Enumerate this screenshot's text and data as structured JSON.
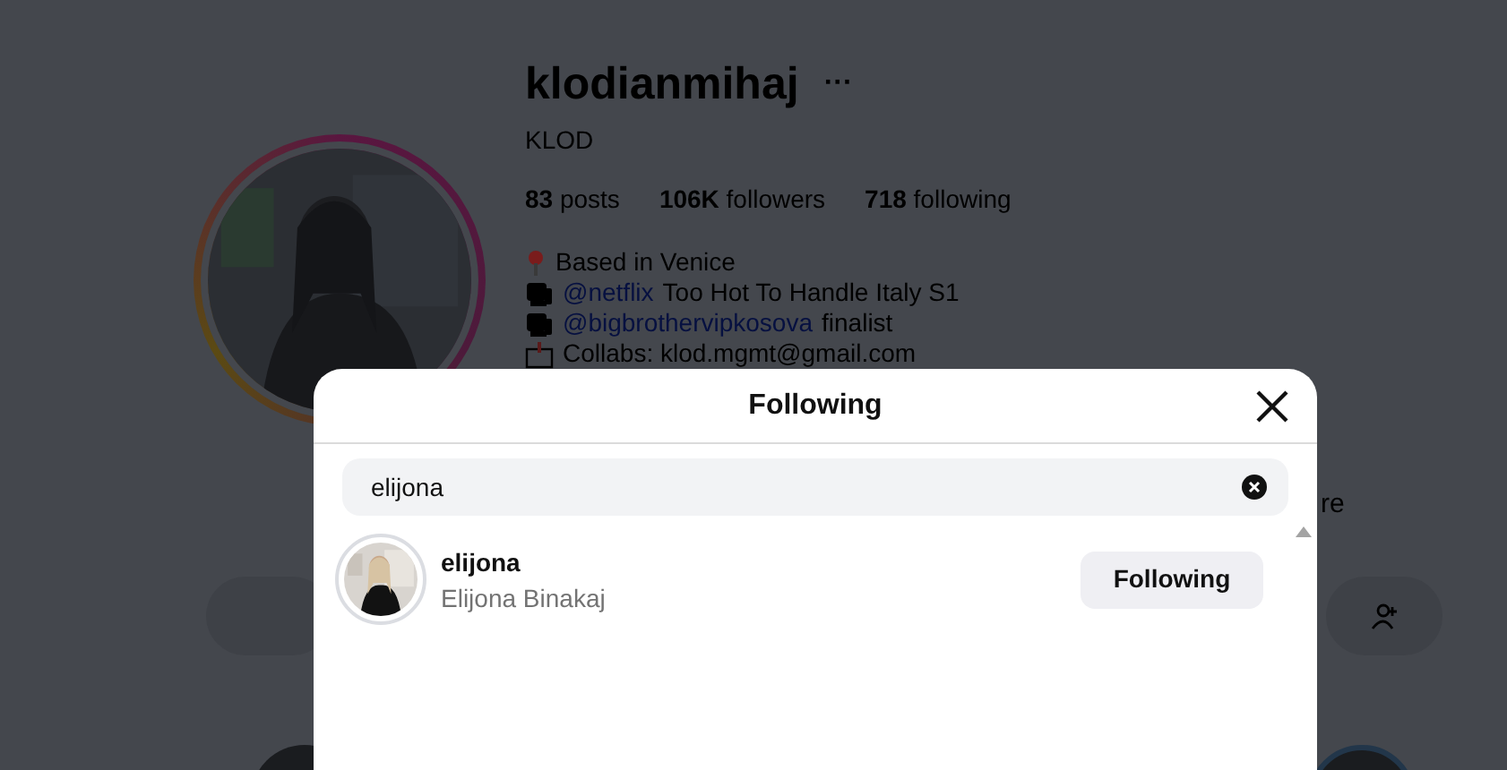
{
  "profile": {
    "username": "klodianmihaj",
    "more": "···",
    "display_name": "KLOD",
    "stats": [
      {
        "count": "83",
        "label": "posts"
      },
      {
        "count": "106K",
        "label": "followers"
      },
      {
        "count": "718",
        "label": "following"
      }
    ],
    "bio": [
      {
        "kind": "pin",
        "text": "Based in Venice"
      },
      {
        "kind": "tv",
        "mention": "@netflix",
        "text": "Too Hot To Handle Italy S1"
      },
      {
        "kind": "tv",
        "mention": "@bigbrothervipkosova",
        "text": "finalist"
      },
      {
        "kind": "mail",
        "text": "Collabs: klod.mgmt@gmail.com"
      }
    ],
    "hidden_text": "re"
  },
  "modal": {
    "title": "Following",
    "search": {
      "value": "elijona"
    },
    "results": [
      {
        "username": "elijona",
        "full_name": "Elijona Binakaj",
        "button": "Following"
      }
    ]
  }
}
